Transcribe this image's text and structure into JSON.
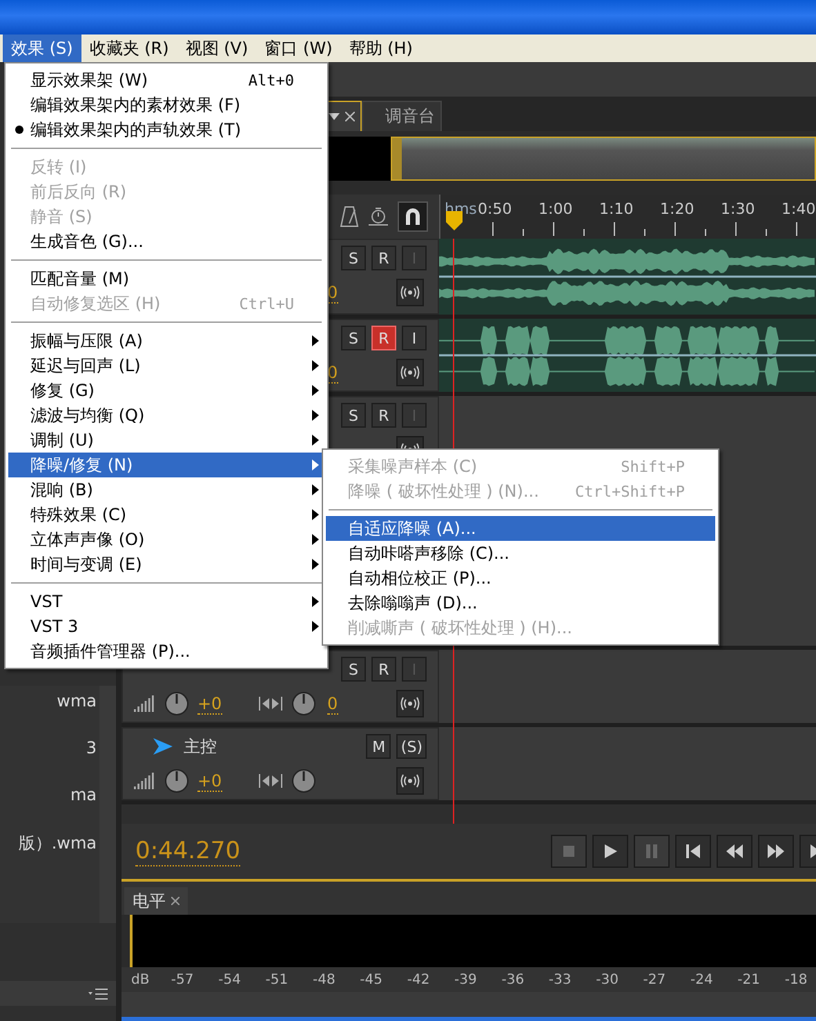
{
  "menu_bar": [
    {
      "label": "效果 (S)",
      "selected": true
    },
    {
      "label": "收藏夹 (R)",
      "selected": false
    },
    {
      "label": "视图 (V)",
      "selected": false
    },
    {
      "label": "窗口 (W)",
      "selected": false
    },
    {
      "label": "帮助 (H)",
      "selected": false
    }
  ],
  "menu": {
    "items": [
      {
        "kind": "item",
        "label": "显示效果架 (W)",
        "shortcut": "Alt+0",
        "checked": false,
        "disabled": false,
        "submenu": false,
        "selected": false
      },
      {
        "kind": "item",
        "label": "编辑效果架内的素材效果 (F)",
        "checked": false,
        "disabled": false,
        "submenu": false,
        "selected": false
      },
      {
        "kind": "item",
        "label": "编辑效果架内的声轨效果 (T)",
        "checked": true,
        "disabled": false,
        "submenu": false,
        "selected": false
      },
      {
        "kind": "separator"
      },
      {
        "kind": "item",
        "label": "反转 (I)",
        "checked": false,
        "disabled": true,
        "submenu": false,
        "selected": false
      },
      {
        "kind": "item",
        "label": "前后反向 (R)",
        "checked": false,
        "disabled": true,
        "submenu": false,
        "selected": false
      },
      {
        "kind": "item",
        "label": "静音 (S)",
        "checked": false,
        "disabled": true,
        "submenu": false,
        "selected": false
      },
      {
        "kind": "item",
        "label": "生成音色 (G)...",
        "checked": false,
        "disabled": false,
        "submenu": false,
        "selected": false
      },
      {
        "kind": "separator"
      },
      {
        "kind": "item",
        "label": "匹配音量 (M)",
        "checked": false,
        "disabled": false,
        "submenu": false,
        "selected": false
      },
      {
        "kind": "item",
        "label": "自动修复选区 (H)",
        "shortcut": "Ctrl+U",
        "checked": false,
        "disabled": true,
        "submenu": false,
        "selected": false
      },
      {
        "kind": "separator"
      },
      {
        "kind": "item",
        "label": "振幅与压限 (A)",
        "checked": false,
        "disabled": false,
        "submenu": true,
        "selected": false
      },
      {
        "kind": "item",
        "label": "延迟与回声 (L)",
        "checked": false,
        "disabled": false,
        "submenu": true,
        "selected": false
      },
      {
        "kind": "item",
        "label": "修复 (G)",
        "checked": false,
        "disabled": false,
        "submenu": true,
        "selected": false
      },
      {
        "kind": "item",
        "label": "滤波与均衡 (Q)",
        "checked": false,
        "disabled": false,
        "submenu": true,
        "selected": false
      },
      {
        "kind": "item",
        "label": "调制 (U)",
        "checked": false,
        "disabled": false,
        "submenu": true,
        "selected": false
      },
      {
        "kind": "item",
        "label": "降噪/修复 (N)",
        "checked": false,
        "disabled": false,
        "submenu": true,
        "selected": true
      },
      {
        "kind": "item",
        "label": "混响 (B)",
        "checked": false,
        "disabled": false,
        "submenu": true,
        "selected": false
      },
      {
        "kind": "item",
        "label": "特殊效果 (C)",
        "checked": false,
        "disabled": false,
        "submenu": true,
        "selected": false
      },
      {
        "kind": "item",
        "label": "立体声声像 (O)",
        "checked": false,
        "disabled": false,
        "submenu": true,
        "selected": false
      },
      {
        "kind": "item",
        "label": "时间与变调 (E)",
        "checked": false,
        "disabled": false,
        "submenu": true,
        "selected": false
      },
      {
        "kind": "separator"
      },
      {
        "kind": "item",
        "label": "VST",
        "checked": false,
        "disabled": false,
        "submenu": true,
        "selected": false
      },
      {
        "kind": "item",
        "label": "VST 3",
        "checked": false,
        "disabled": false,
        "submenu": true,
        "selected": false
      },
      {
        "kind": "item",
        "label": "音频插件管理器 (P)...",
        "checked": false,
        "disabled": false,
        "submenu": false,
        "selected": false
      }
    ]
  },
  "submenu": {
    "items": [
      {
        "kind": "item",
        "label": "采集噪声样本 (C)",
        "shortcut": "Shift+P",
        "checked": false,
        "disabled": true,
        "submenu": false,
        "selected": false
      },
      {
        "kind": "item",
        "label": "降噪 ( 破坏性处理 ) (N)...",
        "shortcut": "Ctrl+Shift+P",
        "checked": false,
        "disabled": true,
        "submenu": false,
        "selected": false
      },
      {
        "kind": "separator"
      },
      {
        "kind": "item",
        "label": "自适应降噪 (A)...",
        "checked": false,
        "disabled": false,
        "submenu": false,
        "selected": true
      },
      {
        "kind": "item",
        "label": "自动咔嗒声移除 (C)...",
        "checked": false,
        "disabled": false,
        "submenu": false,
        "selected": false
      },
      {
        "kind": "item",
        "label": "自动相位校正 (P)...",
        "checked": false,
        "disabled": false,
        "submenu": false,
        "selected": false
      },
      {
        "kind": "item",
        "label": "去除嗡嗡声 (D)...",
        "checked": false,
        "disabled": false,
        "submenu": false,
        "selected": false
      },
      {
        "kind": "item",
        "label": "削减嘶声 ( 破坏性处理 ) (H)...",
        "checked": false,
        "disabled": true,
        "submenu": false,
        "selected": false
      }
    ]
  },
  "left_panel": {
    "files": [
      "wma",
      "3",
      "ma",
      "版）.wma"
    ]
  },
  "tabs": [
    {
      "kind": "editor",
      "selected": true
    },
    {
      "kind": "mixer",
      "label": "调音台",
      "selected": false
    }
  ],
  "ruler": {
    "unit": "hms",
    "labels": [
      "0:50",
      "1:00",
      "1:10",
      "1:20",
      "1:30",
      "1:40"
    ]
  },
  "tracks": [
    {
      "kind": "clip",
      "pan": "0",
      "buttons": [
        {
          "label": "S",
          "active": false,
          "disabled": false
        },
        {
          "label": "R",
          "active": false,
          "disabled": false
        },
        {
          "label": "I",
          "active": false,
          "disabled": true
        }
      ]
    },
    {
      "kind": "clip",
      "pan": "0",
      "buttons": [
        {
          "label": "S",
          "active": false,
          "disabled": false
        },
        {
          "label": "R",
          "active": true,
          "disabled": false
        },
        {
          "label": "I",
          "active": false,
          "disabled": false
        }
      ]
    },
    {
      "kind": "empty",
      "buttons": [
        {
          "label": "S",
          "active": false,
          "disabled": false
        },
        {
          "label": "R",
          "active": false,
          "disabled": false
        },
        {
          "label": "I",
          "active": false,
          "disabled": true
        }
      ]
    },
    {
      "kind": "empty",
      "gain": "+0",
      "pan": "0",
      "buttons": [
        {
          "label": "S",
          "active": false,
          "disabled": false
        },
        {
          "label": "R",
          "active": false,
          "disabled": false
        },
        {
          "label": "I",
          "active": false,
          "disabled": true
        }
      ]
    }
  ],
  "master": {
    "name": "主控",
    "gain": "+0",
    "buttons": [
      {
        "label": "M",
        "active": false,
        "disabled": false
      },
      {
        "label": "(S)",
        "active": false,
        "disabled": false
      }
    ]
  },
  "transport": {
    "time": "0:44.270",
    "buttons": [
      {
        "kind": "stop",
        "disabled": true
      },
      {
        "kind": "play",
        "disabled": false
      },
      {
        "kind": "pause",
        "disabled": true
      },
      {
        "kind": "start",
        "disabled": false
      },
      {
        "kind": "rewind",
        "disabled": false
      },
      {
        "kind": "forward",
        "disabled": false
      },
      {
        "kind": "end",
        "disabled": false
      }
    ]
  },
  "level_meter": {
    "tab": "电平",
    "scale": [
      "dB",
      "-57",
      "-54",
      "-51",
      "-48",
      "-45",
      "-42",
      "-39",
      "-36",
      "-33",
      "-30",
      "-27",
      "-24",
      "-21",
      "-18"
    ]
  }
}
